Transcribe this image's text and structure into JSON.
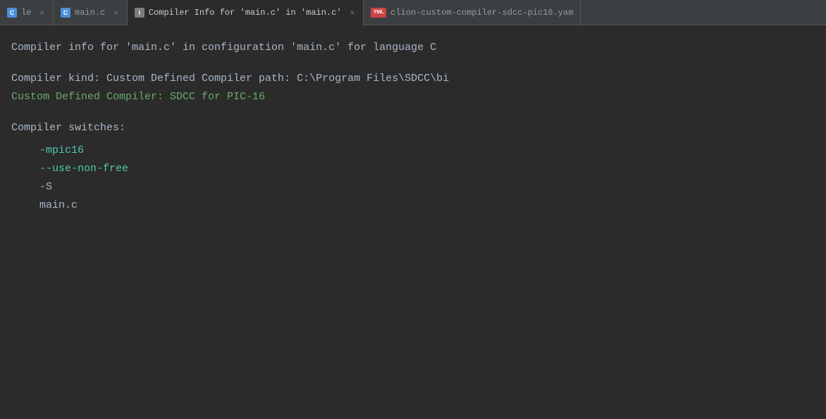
{
  "tabs": [
    {
      "id": "tab-previous",
      "label": "le",
      "icon_type": "c",
      "icon_text": "C",
      "closable": true,
      "active": false
    },
    {
      "id": "tab-main-c",
      "label": "main.c",
      "icon_type": "c",
      "icon_text": "C",
      "closable": true,
      "active": false
    },
    {
      "id": "tab-compiler-info",
      "label": "Compiler Info for 'main.c' in 'main.c'",
      "icon_type": "info",
      "icon_text": "i",
      "closable": true,
      "active": true
    },
    {
      "id": "tab-yaml",
      "label": "clion-custom-compiler-sdcc-pic16.yam",
      "icon_type": "yaml",
      "icon_text": "YML",
      "closable": false,
      "active": false
    }
  ],
  "content": {
    "header": "Compiler info for 'main.c' in configuration 'main.c' for language C",
    "compiler_kind_line": "Compiler kind: Custom Defined Compiler path: C:\\Program Files\\SDCC\\bi",
    "custom_defined_line": "Custom Defined Compiler: SDCC for PIC-16",
    "switches_label": "Compiler switches:",
    "switches": [
      {
        "text": "-mpic16",
        "color": "teal"
      },
      {
        "text": "--use-non-free",
        "color": "teal"
      },
      {
        "text": "-S",
        "color": "plain"
      },
      {
        "text": "main.c",
        "color": "plain"
      }
    ]
  }
}
